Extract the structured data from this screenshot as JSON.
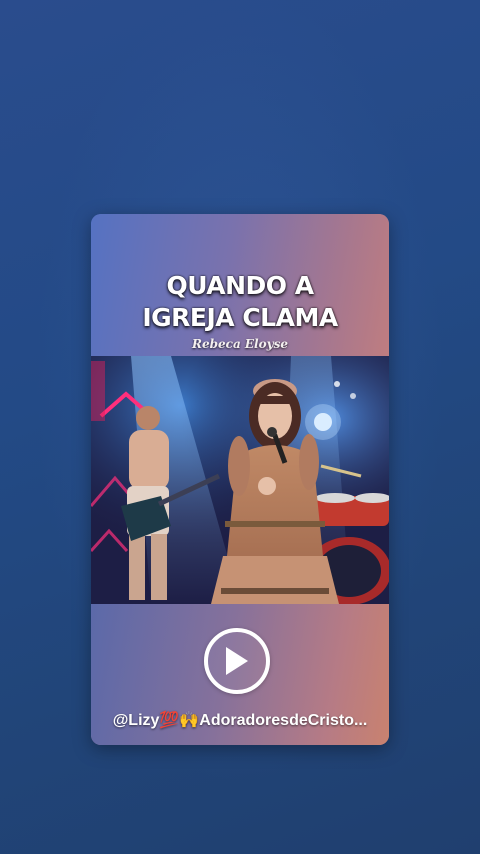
{
  "card": {
    "title_line1": "QUANDO A",
    "title_line2": "IGREJA CLAMA",
    "artist": "Rebeca Eloyse"
  },
  "player": {
    "play_icon": "play-icon",
    "credit_text": "@Lizy💯🙌AdoradoresdeCristo..."
  },
  "colors": {
    "background": "#234a86",
    "card_top_left": "#5572c2",
    "card_bottom_right": "#c9826f",
    "play_ring": "#ffffff"
  }
}
